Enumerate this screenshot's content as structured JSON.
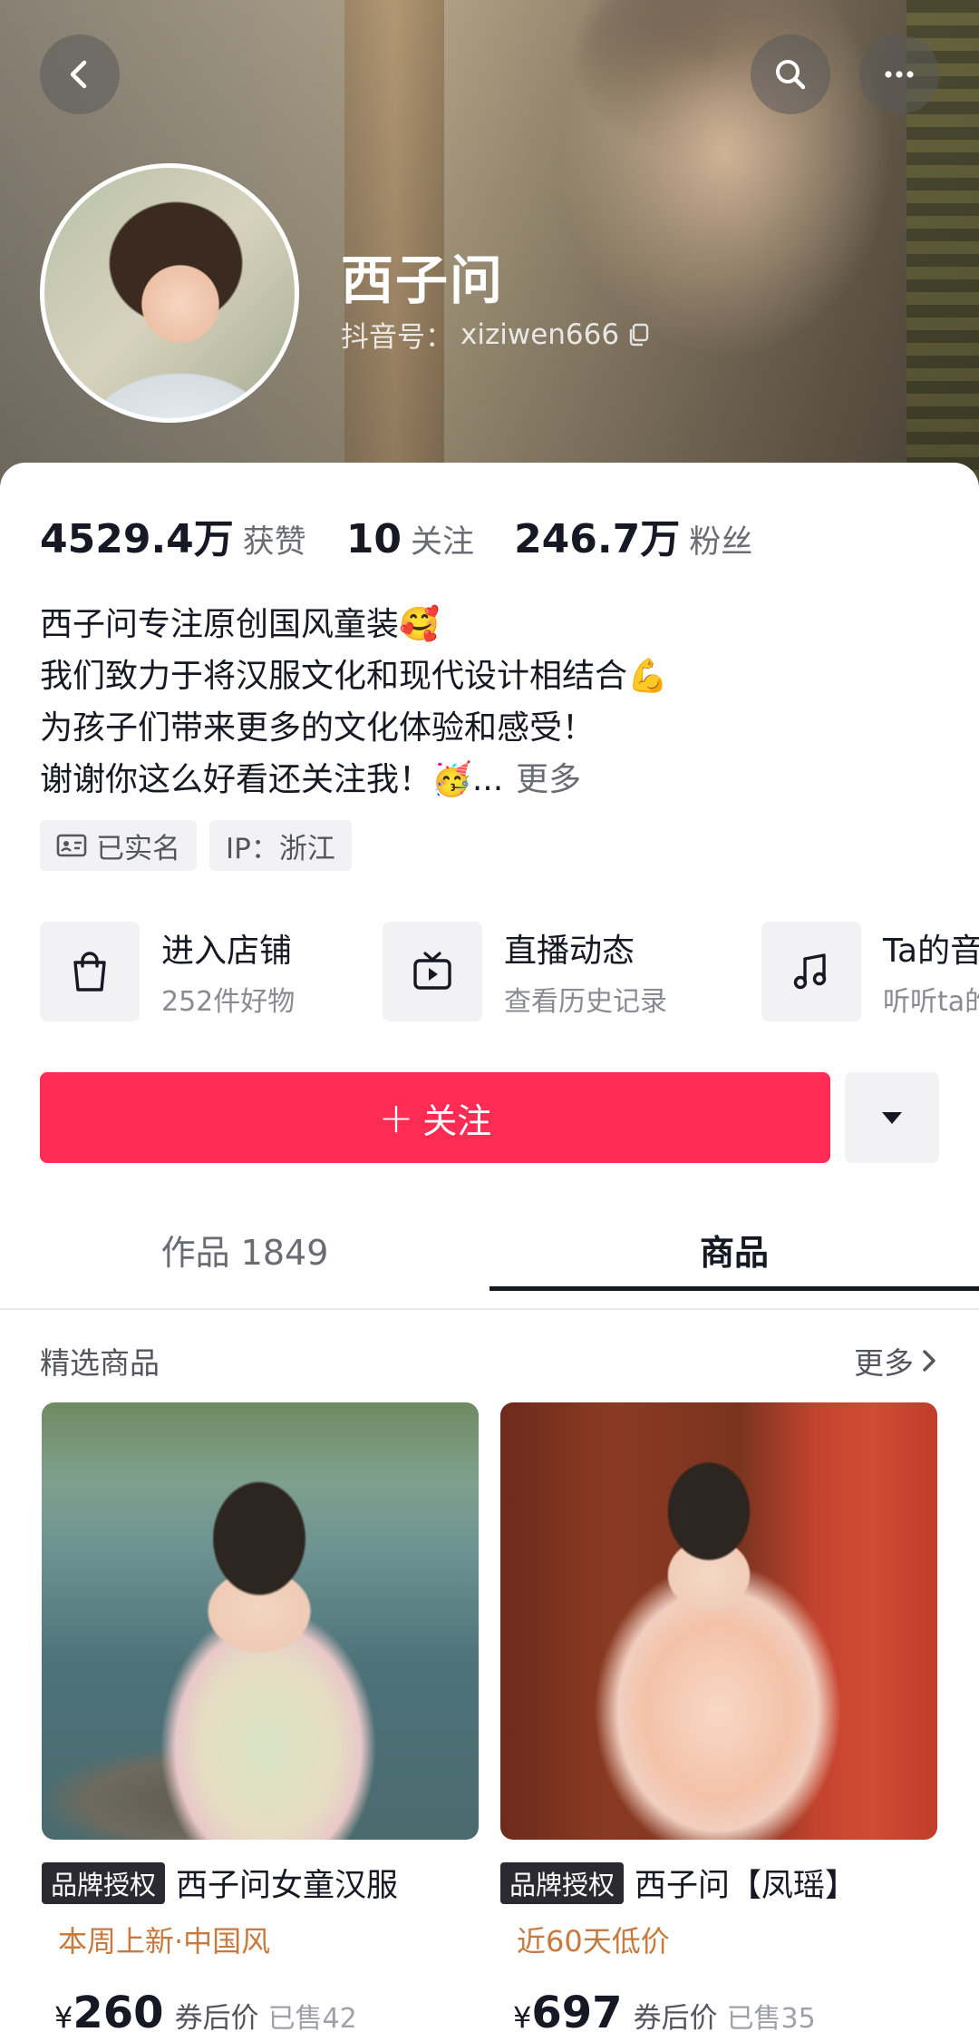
{
  "header": {
    "name": "西子问",
    "id_label": "抖音号：",
    "id_value": "xiziwen666"
  },
  "stats": [
    {
      "num": "4529.4万",
      "label": "获赞"
    },
    {
      "num": "10",
      "label": "关注"
    },
    {
      "num": "246.7万",
      "label": "粉丝"
    }
  ],
  "bio": {
    "line1": "西子问专注原创国风童装🥰",
    "line2": "我们致力于将汉服文化和现代设计相结合💪",
    "line3": "为孩子们带来更多的文化体验和感受！",
    "line4": "谢谢你这么好看还关注我！🥳...",
    "more": "更多"
  },
  "tags": {
    "verified": "已实名",
    "ip": "IP：浙江"
  },
  "quick": [
    {
      "title": "进入店铺",
      "sub": "252件好物",
      "icon": "shopping-bag-icon"
    },
    {
      "title": "直播动态",
      "sub": "查看历史记录",
      "icon": "tv-icon"
    },
    {
      "title": "Ta的音",
      "sub": "听听ta的",
      "icon": "music-note-icon"
    }
  ],
  "actions": {
    "follow_plus": "+",
    "follow_label": "关注"
  },
  "tabs": {
    "works": "作品 1849",
    "goods": "商品"
  },
  "section": {
    "title": "精选商品",
    "more": "更多"
  },
  "products": [
    {
      "badge": "品牌授权",
      "name": "西子问女童汉服",
      "sub": "本周上新·中国风",
      "yen": "¥",
      "price": "260",
      "after": "券后价",
      "sold": "已售42"
    },
    {
      "badge": "品牌授权",
      "name": "西子问【凤瑶】",
      "sub": "近60天低价",
      "yen": "¥",
      "price": "697",
      "after": "券后价",
      "sold": "已售35"
    }
  ],
  "colors": {
    "accent": "#fe2c55",
    "price_sub": "#c77a3c"
  }
}
